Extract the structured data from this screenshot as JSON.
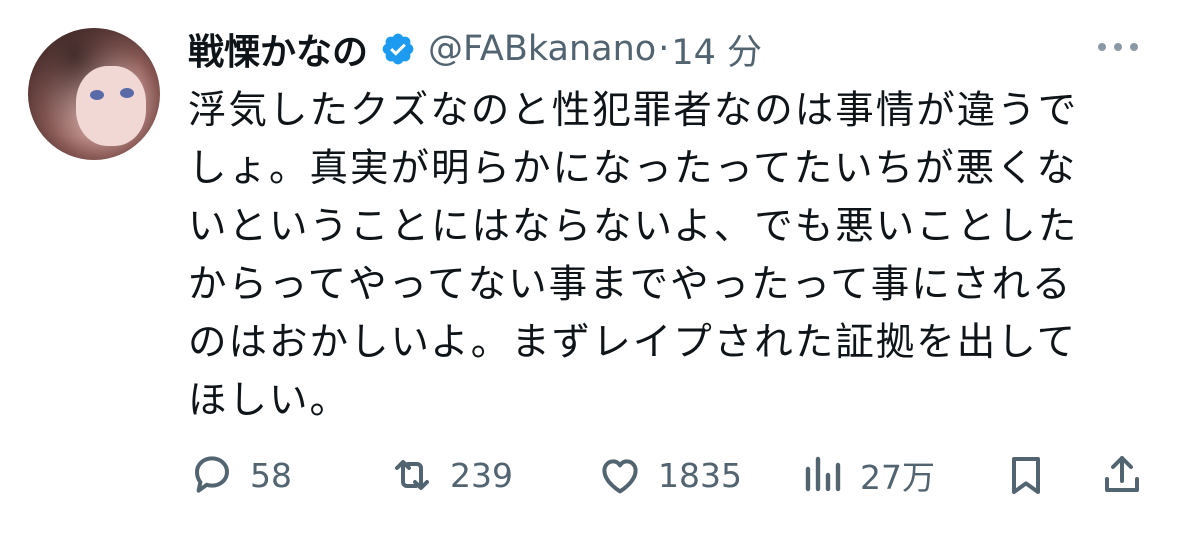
{
  "author": {
    "name": "戦慄かなの",
    "handle": "@FABkanano",
    "separator": "·",
    "time": "14 分"
  },
  "tweet": {
    "lines": [
      "浮気したクズなのと性犯罪者なのは事情が違うで",
      "しょ。真実が明らかになったってたいちが悪くな",
      "いということにはならないよ、でも悪いことした",
      "からってやってない事までやったって事にされる",
      "のはおかしいよ。まずレイプされた証拠を出して",
      "ほしい。"
    ]
  },
  "actions": {
    "replies": "58",
    "reposts": "239",
    "likes": "1835",
    "views": "27万"
  },
  "icons": {
    "verified": "verified-badge-icon",
    "more": "more-dots-icon",
    "reply": "reply-icon",
    "repost": "repost-icon",
    "like": "heart-icon",
    "views": "views-chart-icon",
    "bookmark": "bookmark-icon",
    "share": "share-icon"
  },
  "colors": {
    "text": "#0f1419",
    "secondary": "#536471",
    "verified": "#1d9bf0"
  }
}
